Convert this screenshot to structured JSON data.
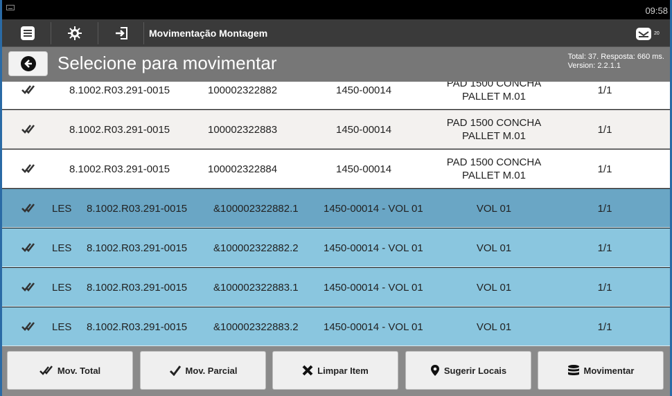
{
  "status_bar": {
    "time": "09:58"
  },
  "toolbar": {
    "title": "Movimentação Montagem",
    "mail_badge": "20"
  },
  "header": {
    "title": "Selecione para movimentar",
    "info_line1": "Total: 37. Resposta: 660 ms.",
    "info_line2": "Version: 2.2.1.1"
  },
  "rows": [
    {
      "style": "white",
      "tipo": "",
      "codigo": "8.1002.R03.291-0015",
      "serial": "100002322882",
      "item": "1450-00014",
      "descricao_l1": "PAD 1500 CONCHA",
      "descricao_l2": "PALLET M.01",
      "qtd": "1/1"
    },
    {
      "style": "gray",
      "tipo": "",
      "codigo": "8.1002.R03.291-0015",
      "serial": "100002322883",
      "item": "1450-00014",
      "descricao_l1": "PAD 1500 CONCHA",
      "descricao_l2": "PALLET M.01",
      "qtd": "1/1"
    },
    {
      "style": "white",
      "tipo": "",
      "codigo": "8.1002.R03.291-0015",
      "serial": "100002322884",
      "item": "1450-00014",
      "descricao_l1": "PAD 1500 CONCHA",
      "descricao_l2": "PALLET M.01",
      "qtd": "1/1"
    },
    {
      "style": "dark",
      "tipo": "LES",
      "codigo": "8.1002.R03.291-0015",
      "serial": "&100002322882.1",
      "item": "1450-00014 - VOL 01",
      "descricao_l1": "VOL 01",
      "descricao_l2": "",
      "qtd": "1/1"
    },
    {
      "style": "blue",
      "tipo": "LES",
      "codigo": "8.1002.R03.291-0015",
      "serial": "&100002322882.2",
      "item": "1450-00014 - VOL 01",
      "descricao_l1": "VOL 01",
      "descricao_l2": "",
      "qtd": "1/1"
    },
    {
      "style": "blue",
      "tipo": "LES",
      "codigo": "8.1002.R03.291-0015",
      "serial": "&100002322883.1",
      "item": "1450-00014 - VOL 01",
      "descricao_l1": "VOL 01",
      "descricao_l2": "",
      "qtd": "1/1"
    },
    {
      "style": "blue",
      "tipo": "LES",
      "codigo": "8.1002.R03.291-0015",
      "serial": "&100002322883.2",
      "item": "1450-00014 - VOL 01",
      "descricao_l1": "VOL 01",
      "descricao_l2": "",
      "qtd": "1/1"
    }
  ],
  "actions": {
    "mov_total": "Mov. Total",
    "mov_parcial": "Mov. Parcial",
    "limpar_item": "Limpar Item",
    "sugerir_locais": "Sugerir Locais",
    "movimentar": "Movimentar"
  },
  "icons": {
    "menu": "menu-icon",
    "settings": "gear-icon",
    "exit": "logout-icon",
    "mail": "mail-icon",
    "back": "back-arrow-icon",
    "check": "double-check-icon"
  },
  "colors": {
    "row_selected_dark": "#6aa6c5",
    "row_selected": "#8ac6df",
    "toolbar": "#3a3a3a",
    "header": "#777777"
  }
}
